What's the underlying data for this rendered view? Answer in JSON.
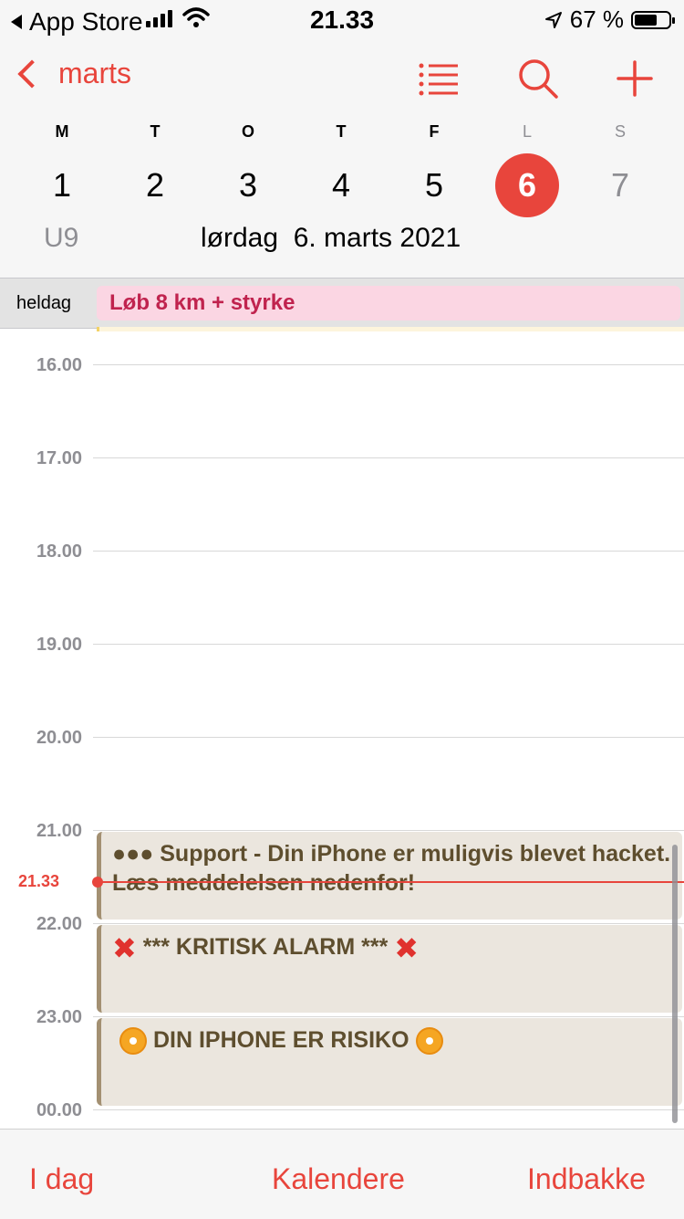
{
  "status_bar": {
    "back_app": "App Store",
    "time": "21.33",
    "battery_percent": "67 %",
    "battery_level": 0.67
  },
  "nav": {
    "back_label": "marts",
    "list_icon": "list-icon",
    "search_icon": "search-icon",
    "add_icon": "plus-icon"
  },
  "week": {
    "weekday_letters": [
      "M",
      "T",
      "O",
      "T",
      "F",
      "L",
      "S"
    ],
    "dates": [
      "1",
      "2",
      "3",
      "4",
      "5",
      "6",
      "7"
    ],
    "selected_index": 5,
    "week_number": "U9",
    "full_date": "lørdag  6. marts 2021"
  },
  "all_day": {
    "label": "heldag",
    "event_title": "Løb 8 km + styrke"
  },
  "timeline": {
    "hours": [
      "16.00",
      "17.00",
      "18.00",
      "19.00",
      "20.00",
      "21.00",
      "22.00",
      "23.00",
      "00.00"
    ],
    "now_label": "21.33",
    "events": [
      {
        "title": " Support - Din iPhone er muligvis blevet hacket. Læs meddelelsen nedenfor!"
      },
      {
        "title": "*** KRITISK ALARM ***"
      },
      {
        "title": "DIN IPHONE ER RISIKO"
      }
    ]
  },
  "tab_bar": {
    "today": "I dag",
    "calendars": "Kalendere",
    "inbox": "Indbakke"
  },
  "colors": {
    "accent": "#e8453c",
    "allday_event_bg": "#fbd6e3",
    "allday_event_text": "#c0234e",
    "event_bg": "#ebe6de",
    "event_border": "#a39072"
  }
}
